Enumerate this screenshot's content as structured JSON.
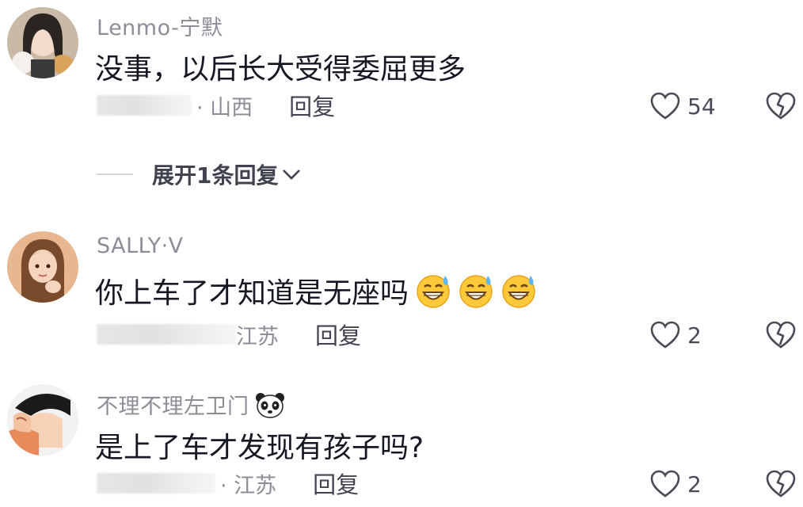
{
  "comments": [
    {
      "username": "Lenmo-宁默",
      "text": "没事，以后长大受得委屈更多",
      "location": "· 山西",
      "reply_label": "回复",
      "likes": "54",
      "expand_label": "展开1条回复"
    },
    {
      "username": "SALLY·V",
      "text": "你上车了才知道是无座吗",
      "emojis": [
        "grin-sweat-emoji",
        "grin-sweat-emoji",
        "grin-sweat-emoji"
      ],
      "location": "江苏",
      "reply_label": "回复",
      "likes": "2"
    },
    {
      "username": "不理不理左卫门",
      "username_icon": "panda-icon",
      "text": "是上了车才发现有孩子吗?",
      "location": "· 江苏",
      "reply_label": "回复",
      "likes": "2"
    }
  ],
  "colors": {
    "username": "#8d8d97",
    "content": "#161823",
    "meta": "#414250"
  }
}
